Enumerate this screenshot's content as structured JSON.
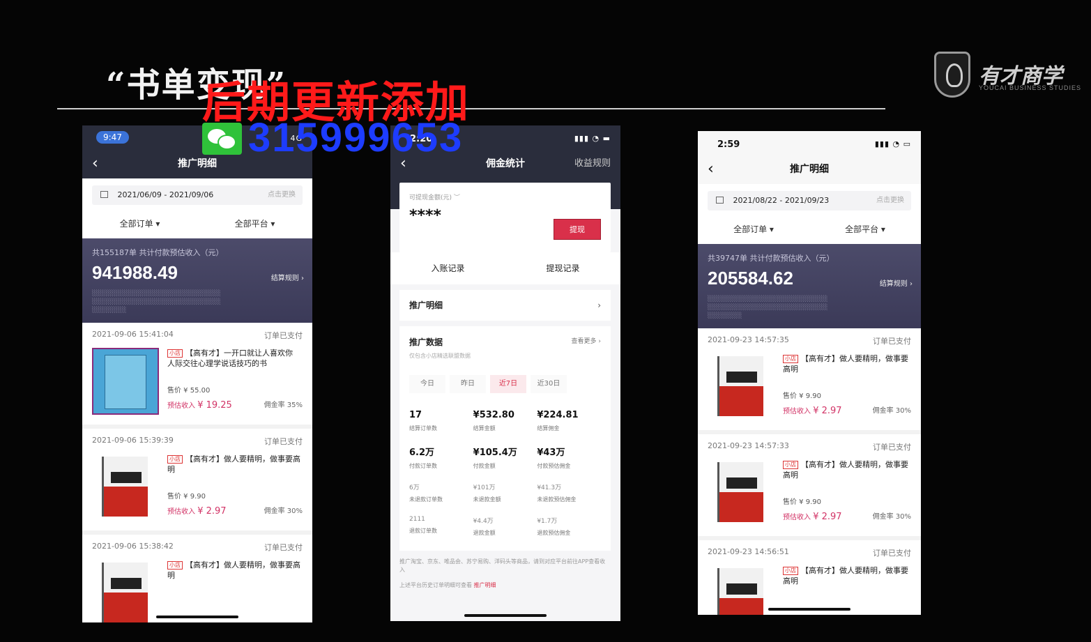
{
  "slide": {
    "title": "“书单变现”",
    "overlay_text": "后期更新添加",
    "overlay_number": "315999653"
  },
  "logo": {
    "name": "有才商学",
    "subtitle": "YOUCAI BUSINESS STUDIES"
  },
  "colors": {
    "accent_red": "#d9304a",
    "income_pink": "#d23366",
    "summary_bg": "#3b3a58",
    "header_dark": "#2a2d3c"
  },
  "left_phone": {
    "time": "9:47",
    "status": "4G",
    "nav_title": "推广明细",
    "back_icon": "chevron-left-icon",
    "date_range": "2021/06/09 - 2021/09/06",
    "date_action": "点击更换",
    "filter_orders": "全部订单 ▾",
    "filter_platform": "全部平台 ▾",
    "summary_caption": "共155187单 共计付款预估收入（元）",
    "summary_amount": "941988.49",
    "summary_rule": "结算规则 ›",
    "orders": [
      {
        "time": "2021-09-06 15:41:04",
        "status": "订单已支付",
        "tag": "小店",
        "title": "【高有才】一开口就让人喜欢你 人际交往心理学说话技巧的书",
        "price": "售价 ¥ 55.00",
        "income_label": "预估收入",
        "income": "¥ 19.25",
        "rate": "佣金率 35%"
      },
      {
        "time": "2021-09-06 15:39:39",
        "status": "订单已支付",
        "tag": "小店",
        "title": "【高有才】做人要精明，做事要高明",
        "price": "售价 ¥ 9.90",
        "income_label": "预估收入",
        "income": "¥ 2.97",
        "rate": "佣金率 30%"
      },
      {
        "time": "2021-09-06 15:38:42",
        "status": "订单已支付",
        "tag": "小店",
        "title": "【高有才】做人要精明，做事要高明"
      }
    ]
  },
  "mid_phone": {
    "time": "2:20",
    "nav_title": "佣金统计",
    "nav_right": "收益规则",
    "back_icon": "chevron-left-icon",
    "withdrawable_label": "可提现金额(元)",
    "withdrawable_value": "****",
    "withdraw_button": "提现",
    "income_record": "入账记录",
    "withdraw_record": "提现记录",
    "detail_link": "推广明细",
    "data_title": "推广数据",
    "data_more": "查看更多 ›",
    "data_sub": "仅包含小店精选联盟数据",
    "ranges": [
      "今日",
      "昨日",
      "近7日",
      "近30日"
    ],
    "active_range": "近7日",
    "stats": [
      {
        "value": "17",
        "label": "结算订单数"
      },
      {
        "value": "¥532.80",
        "label": "结算金额"
      },
      {
        "value": "¥224.81",
        "label": "结算佣金"
      },
      {
        "value": "6.2万",
        "label": "付款订单数"
      },
      {
        "value": "¥105.4万",
        "label": "付款金额"
      },
      {
        "value": "¥43万",
        "label": "付款预估佣金"
      },
      {
        "value": "6万",
        "label": "未退款订单数"
      },
      {
        "value": "¥101万",
        "label": "未退款金额"
      },
      {
        "value": "¥41.3万",
        "label": "未退款预估佣金"
      },
      {
        "value": "2111",
        "label": "退款订单数"
      },
      {
        "value": "¥4.4万",
        "label": "退款金额"
      },
      {
        "value": "¥1.7万",
        "label": "退款预估佣金"
      }
    ],
    "footer_note": "推广淘宝、京东、唯品会、苏宁易购、洋码头等商品，请到对应平台前往APP查看收入",
    "footer_link_prefix": "上述平台历史订单明细可查看",
    "footer_link": "推广明细"
  },
  "right_phone": {
    "time": "2:59",
    "nav_title": "推广明细",
    "back_icon": "chevron-left-icon",
    "date_range": "2021/08/22 - 2021/09/23",
    "date_action": "点击更换",
    "filter_orders": "全部订单 ▾",
    "filter_platform": "全部平台 ▾",
    "summary_caption": "共39747单 共计付款预估收入（元）",
    "summary_amount": "205584.62",
    "summary_rule": "结算规则 ›",
    "orders": [
      {
        "time": "2021-09-23 14:57:35",
        "status": "订单已支付",
        "tag": "小店",
        "title": "【高有才】做人要精明，做事要高明",
        "price": "售价 ¥ 9.90",
        "income_label": "预估收入",
        "income": "¥ 2.97",
        "rate": "佣金率 30%"
      },
      {
        "time": "2021-09-23 14:57:33",
        "status": "订单已支付",
        "tag": "小店",
        "title": "【高有才】做人要精明，做事要高明",
        "price": "售价 ¥ 9.90",
        "income_label": "预估收入",
        "income": "¥ 2.97",
        "rate": "佣金率 30%"
      },
      {
        "time": "2021-09-23 14:56:51",
        "status": "订单已支付",
        "tag": "小店",
        "title": "【高有才】做人要精明，做事要高明"
      }
    ]
  }
}
